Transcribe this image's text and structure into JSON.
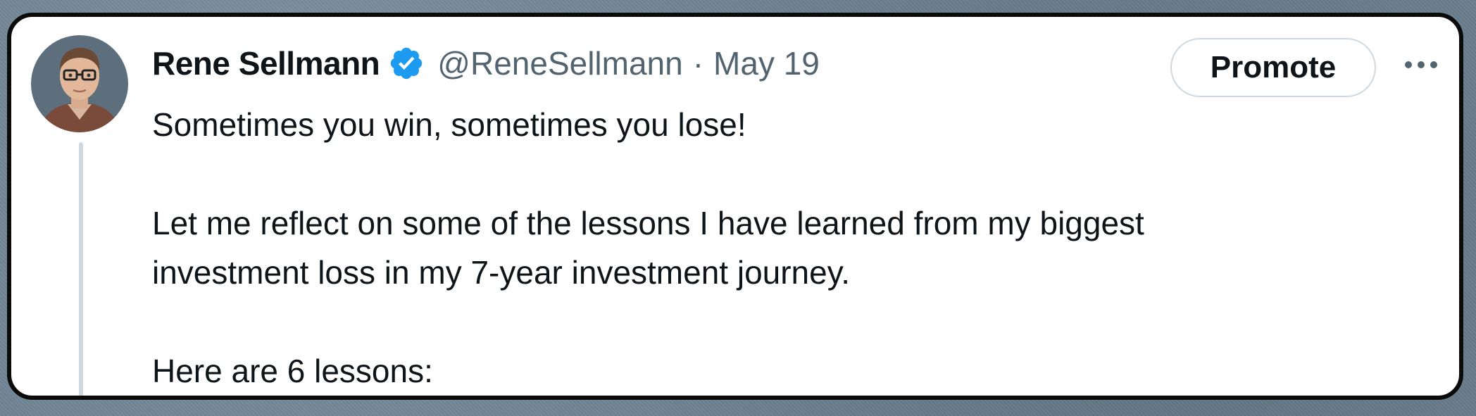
{
  "author": {
    "name": "Rene Sellmann",
    "handle": "@ReneSellmann",
    "separator": "·",
    "date": "May 19",
    "verified": true,
    "avatar_icon": "profile-photo"
  },
  "actions": {
    "promote_label": "Promote",
    "more_icon": "more-horizontal-icon"
  },
  "tweet": {
    "line1": "Sometimes you win, sometimes you lose!",
    "line2": "Let me reflect on some of the lessons I have learned from my biggest",
    "line3": "investment loss in my 7-year investment journey.",
    "line4": "Here are 6 lessons:"
  },
  "colors": {
    "verified_blue": "#1d9bf0",
    "secondary_text": "#536471",
    "primary_text": "#0f1419",
    "thread_line": "#cfd9de",
    "card_border": "#0b0b0b"
  }
}
